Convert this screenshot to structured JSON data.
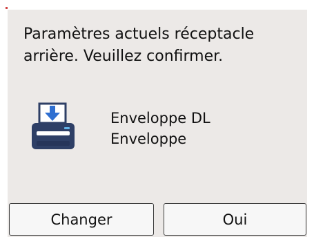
{
  "dialog": {
    "message_line1": "Paramètres actuels réceptacle",
    "message_line2": "arrière. Veuillez confirmer.",
    "media_size": "Enveloppe DL",
    "media_type": "Enveloppe",
    "icon": "rear-tray-printer-icon"
  },
  "buttons": {
    "change_label": "Changer",
    "confirm_label": "Oui"
  },
  "colors": {
    "panel_background": "#ece9e7",
    "printer_body": "#2e3f66",
    "arrow": "#2f6fd1"
  }
}
